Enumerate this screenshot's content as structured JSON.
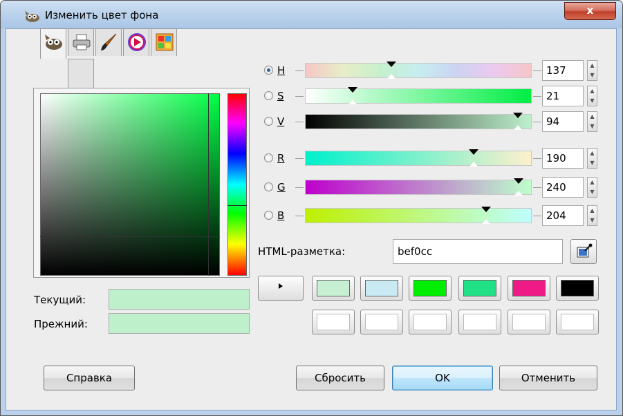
{
  "window": {
    "title": "Изменить цвет фона",
    "close_label": "x"
  },
  "tabs": [
    {
      "name": "gimp-selector-tab"
    },
    {
      "name": "cmyk-tab"
    },
    {
      "name": "watercolor-tab"
    },
    {
      "name": "wheel-tab"
    },
    {
      "name": "palette-tab"
    }
  ],
  "swatches": {
    "current_label": "Текущий:",
    "previous_label": "Прежний:",
    "current_color": "#bef0cc",
    "previous_color": "#bef0cc"
  },
  "channels": [
    {
      "key": "h",
      "label": "H",
      "value": "137",
      "checked": true
    },
    {
      "key": "s",
      "label": "S",
      "value": "21",
      "checked": false
    },
    {
      "key": "v",
      "label": "V",
      "value": "94",
      "checked": false
    },
    {
      "key": "r",
      "label": "R",
      "value": "190",
      "checked": false
    },
    {
      "key": "g",
      "label": "G",
      "value": "240",
      "checked": false
    },
    {
      "key": "b",
      "label": "B",
      "value": "204",
      "checked": false
    }
  ],
  "html_notation": {
    "label": "HTML-разметка:",
    "value": "bef0cc"
  },
  "history": {
    "row1": [
      "#c7f0d2",
      "#c9eaf3",
      "#00ee00",
      "#22e086",
      "#ee1a86",
      "#000000"
    ],
    "row2": [
      "#ffffff",
      "#ffffff",
      "#ffffff",
      "#ffffff",
      "#ffffff",
      "#ffffff"
    ]
  },
  "buttons": {
    "help": "Справка",
    "reset": "Сбросить",
    "ok": "OK",
    "cancel": "Отменить"
  }
}
